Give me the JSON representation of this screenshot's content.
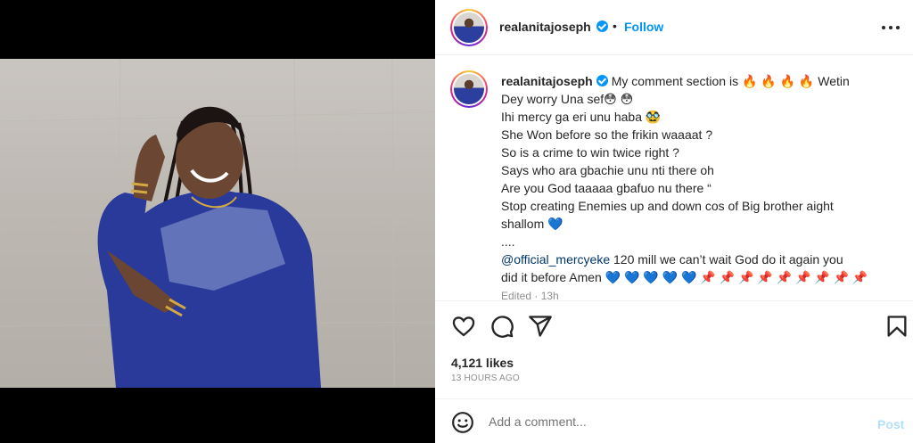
{
  "header": {
    "username": "realanitajoseph",
    "separator": "•",
    "follow_label": "Follow",
    "more_icon": "more-options-icon"
  },
  "caption": {
    "username": "realanitajoseph",
    "lines": [
      "My comment section is 🔥 🔥 🔥 🔥 Wetin",
      "Dey worry Una sef😳 😳",
      "Ihi mercy ga eri unu haba 🥸",
      "She Won before so the frikin waaaat ?",
      "So is a crime to win twice right ?",
      "Says who ara gbachie unu nti there oh",
      "Are you God taaaaa gbafuo nu there “",
      "Stop creating Enemies up and down cos of Big brother aight",
      "shallom 💙",
      "....",
      "",
      "did it before Amen 💙 💙 💙 💙 💙 📌 📌 📌 📌 📌 📌 📌 📌 📌"
    ],
    "mention": "@official_mercyeke",
    "mention_rest": " 120 mill we can’t wait God do it again you",
    "edited": "Edited · 13h"
  },
  "actions": {
    "like_icon": "heart-icon",
    "comment_icon": "comment-icon",
    "share_icon": "share-icon",
    "save_icon": "bookmark-icon"
  },
  "likes": "4,121 likes",
  "timestamp": "13 HOURS AGO",
  "comment_bar": {
    "emoji_icon": "emoji-icon",
    "placeholder": "Add a comment...",
    "post_label": "Post"
  },
  "colors": {
    "accent": "#0095f6",
    "post_disabled": "#b2dffc",
    "mention": "#00376b",
    "muted": "#8e8e8e"
  }
}
